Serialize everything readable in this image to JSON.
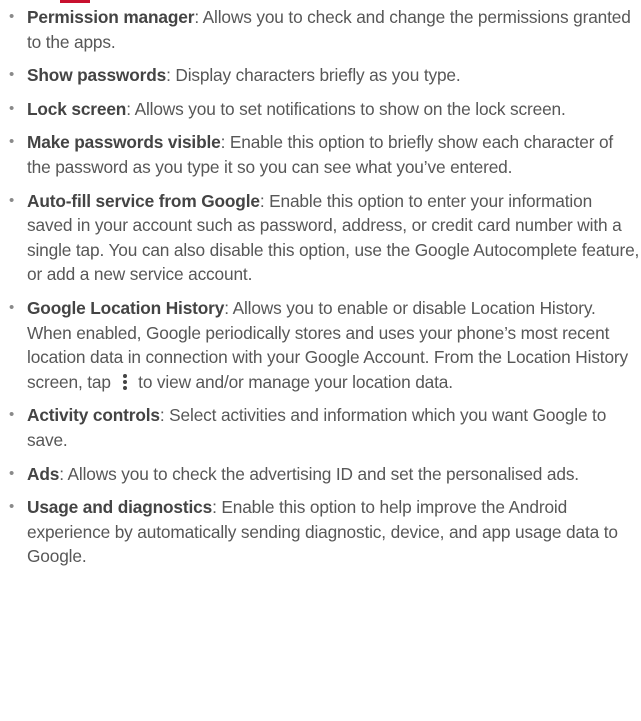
{
  "settings_list": {
    "items": [
      {
        "term": "Permission manager",
        "description": ": Allows you to check and change the permissions granted to the apps."
      },
      {
        "term": "Show passwords",
        "description": ": Display characters briefly as you type."
      },
      {
        "term": "Lock screen",
        "description": ": Allows you to set notifications to show on the lock screen."
      },
      {
        "term": "Make passwords visible",
        "description": ": Enable this option to briefly show each character of the password as you type it so you can see what you’ve entered."
      },
      {
        "term": "Auto-fill service from Google",
        "description": ": Enable this option to enter your information saved in your account such as password, address, or credit card number with a single tap. You can also disable this option, use the Google Autocomplete feature, or add a new service account."
      },
      {
        "term": "Google Location History",
        "description": ": Allows you to enable or disable Location History. When enabled, Google periodically stores and uses your phone’s most recent location data in connection with your Google Account. From the Location History screen, tap",
        "description_after_icon": "to view and/or manage your location data.",
        "icon": "more-options-icon"
      },
      {
        "term": "Activity controls",
        "description": ": Select activities and information which you want Google to save."
      },
      {
        "term": "Ads",
        "description": ": Allows you to check the advertising ID and set the personalised ads."
      },
      {
        "term": "Usage and diagnostics",
        "description": ": Enable this option to help improve the Android experience by automatically sending diagnostic, device, and app usage data to Google."
      }
    ],
    "bullet": "•",
    "accent_color": "#c8102e"
  }
}
